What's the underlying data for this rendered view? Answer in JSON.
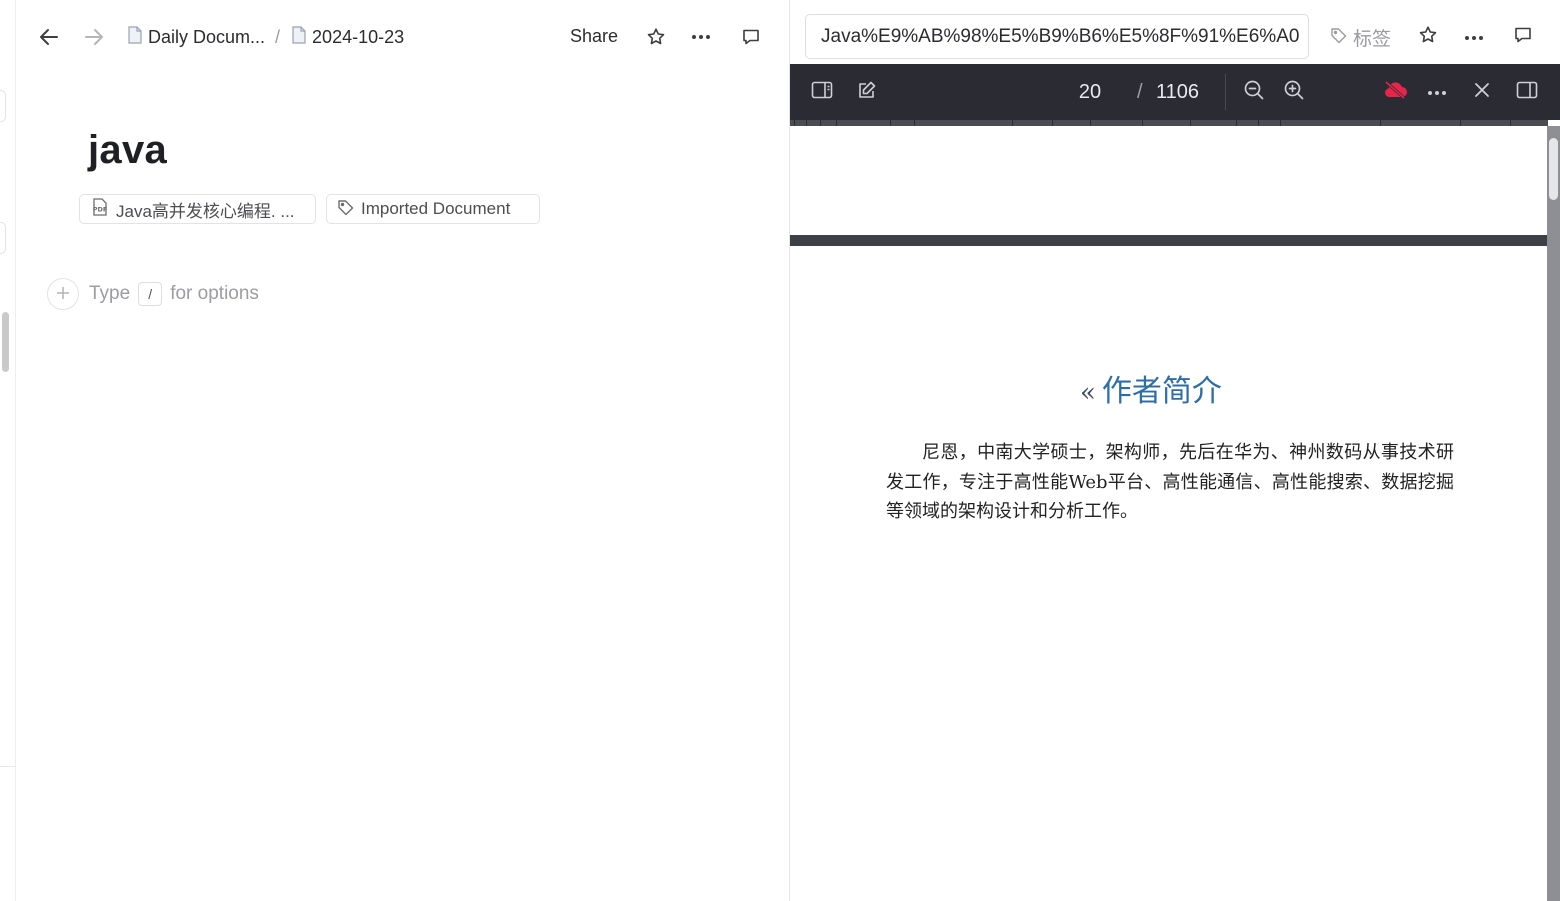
{
  "doc": {
    "breadcrumb": [
      {
        "label": "Daily Docum..."
      },
      {
        "label": "2024-10-23"
      }
    ],
    "breadcrumb_sep": "/",
    "share_label": "Share",
    "title": "java",
    "attachment_chip": "Java高并发核心编程. ...",
    "tag_chip": "Imported Document",
    "placeholder": {
      "before": "Type",
      "key": "/",
      "after": "for options"
    }
  },
  "pdf": {
    "url": "Java%E9%AB%98%E5%B9%B6%E5%8F%91%E6%A0",
    "tag_label": "标签",
    "current_page": "20",
    "page_sep": "/",
    "total_pages": "1106",
    "page": {
      "heading_mark": "«",
      "heading": "作者简介",
      "paragraph": "尼恩，中南大学硕士，架构师，先后在华为、神州数码从事技术研发工作，专注于高性能Web平台、高性能通信、高性能搜索、数据挖掘等领域的架构设计和分析工作。"
    }
  },
  "icons": {
    "back": "arrow-left-icon",
    "forward": "arrow-right-icon",
    "page": "page-icon",
    "star": "star-icon",
    "more": "more-icon",
    "comment": "comment-icon",
    "pdf": "pdf-icon",
    "tag": "tag-icon",
    "sidebar": "sidebar-icon",
    "edit": "edit-icon",
    "zoom_out": "zoom-out-icon",
    "zoom_in": "zoom-in-icon",
    "cloud_off": "cloud-off-icon",
    "close": "close-icon"
  },
  "colors": {
    "toolbar_bg": "#2a2b33",
    "heading_blue": "#2e6ea6",
    "cloud_red": "#e5264a"
  }
}
